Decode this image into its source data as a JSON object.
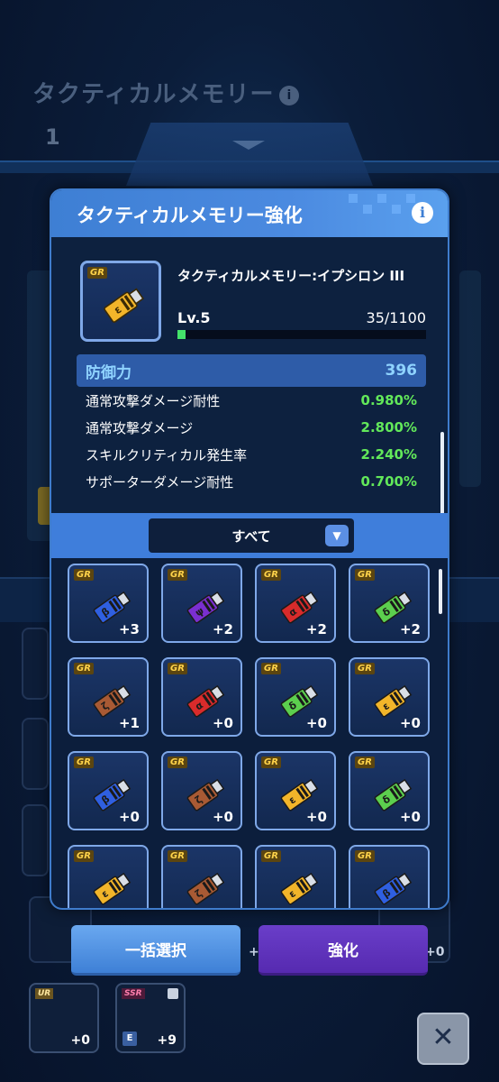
{
  "background": {
    "screen_title": "タクティカルメモリー",
    "info_icon": "info-icon",
    "slot_number": "1",
    "bottom_plus_labels": [
      "+0",
      "+0",
      "+0",
      "+9"
    ]
  },
  "modal": {
    "title": "タクティカルメモリー強化",
    "info_icon": "info-icon",
    "item": {
      "rarity": "GR",
      "name": "タクティカルメモリー:イプシロン III",
      "level_label": "Lv.5",
      "exp_current": 35,
      "exp_max": 1100,
      "exp_text": "35/1100",
      "color": "#f2b52a"
    },
    "main_stat": {
      "label": "防御力",
      "value": "396"
    },
    "sub_stats": [
      {
        "label": "通常攻撃ダメージ耐性",
        "value": "0.980%"
      },
      {
        "label": "通常攻撃ダメージ",
        "value": "2.800%"
      },
      {
        "label": "スキルクリティカル発生率",
        "value": "2.240%"
      },
      {
        "label": "サポーターダメージ耐性",
        "value": "0.700%"
      }
    ],
    "filter": {
      "selected": "すべて",
      "icon": "chevron-down-icon"
    },
    "materials": [
      {
        "rarity": "GR",
        "color": "#2f5fe0",
        "glyph": "β",
        "plus": "+3"
      },
      {
        "rarity": "GR",
        "color": "#7a2fd0",
        "glyph": "ψ",
        "plus": "+2"
      },
      {
        "rarity": "GR",
        "color": "#d82b2b",
        "glyph": "α",
        "plus": "+2"
      },
      {
        "rarity": "GR",
        "color": "#5ccf4e",
        "glyph": "δ",
        "plus": "+2"
      },
      {
        "rarity": "GR",
        "color": "#a85a34",
        "glyph": "ζ",
        "plus": "+1"
      },
      {
        "rarity": "GR",
        "color": "#d82b2b",
        "glyph": "α",
        "plus": "+0"
      },
      {
        "rarity": "GR",
        "color": "#5ccf4e",
        "glyph": "δ",
        "plus": "+0"
      },
      {
        "rarity": "GR",
        "color": "#f2b52a",
        "glyph": "ε",
        "plus": "+0"
      },
      {
        "rarity": "GR",
        "color": "#2f5fe0",
        "glyph": "β",
        "plus": "+0"
      },
      {
        "rarity": "GR",
        "color": "#a85a34",
        "glyph": "ζ",
        "plus": "+0"
      },
      {
        "rarity": "GR",
        "color": "#f2b52a",
        "glyph": "ε",
        "plus": "+0"
      },
      {
        "rarity": "GR",
        "color": "#5ccf4e",
        "glyph": "δ",
        "plus": "+0"
      },
      {
        "rarity": "GR",
        "color": "#f2b52a",
        "glyph": "ε",
        "plus": ""
      },
      {
        "rarity": "GR",
        "color": "#a85a34",
        "glyph": "ζ",
        "plus": ""
      },
      {
        "rarity": "GR",
        "color": "#f2b52a",
        "glyph": "ε",
        "plus": ""
      },
      {
        "rarity": "GR",
        "color": "#2f5fe0",
        "glyph": "β",
        "plus": ""
      }
    ]
  },
  "buttons": {
    "select_all": "一括選択",
    "enhance": "強化",
    "close": "✕"
  },
  "bottom_cards": [
    {
      "rarity": "UR",
      "plus": "+0"
    },
    {
      "rarity": "SSR",
      "plus": "+9",
      "tag": "E"
    }
  ],
  "colors": {
    "accent": "#3f7edb",
    "header": "#4b8ae0",
    "stat_value": "#62e85a",
    "exp_fill": "#44e26a",
    "enhance_button": "#5e34bd"
  }
}
